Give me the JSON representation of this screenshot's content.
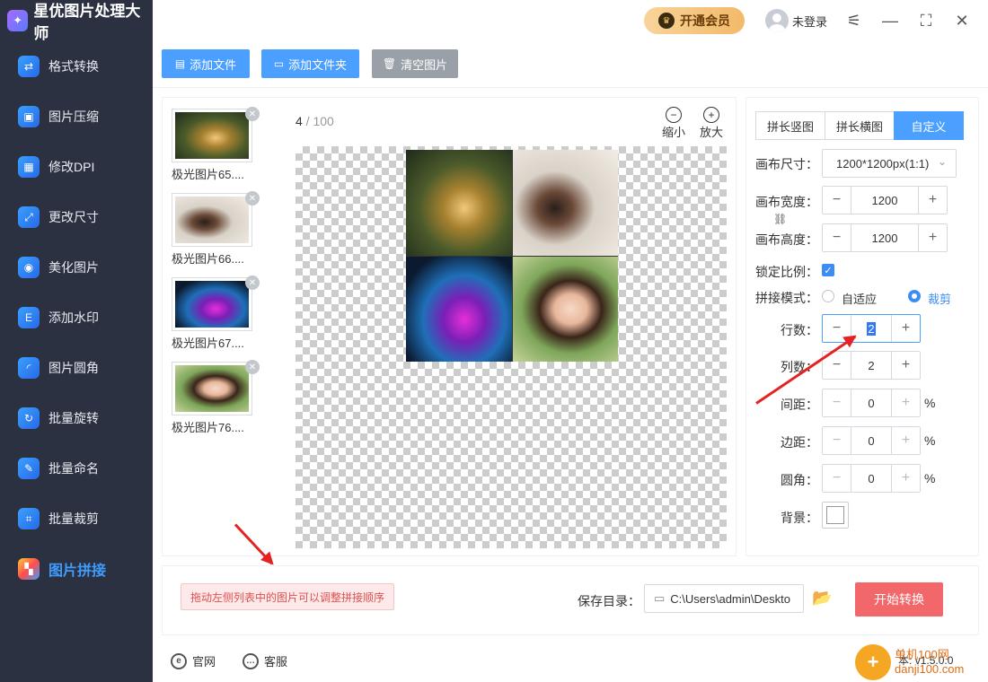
{
  "app": {
    "title": "星优图片处理大师",
    "version": "v1.5.0.0"
  },
  "sidebar": {
    "items": [
      {
        "label": "格式转换",
        "icon": "format-convert-icon"
      },
      {
        "label": "图片压缩",
        "icon": "compress-icon"
      },
      {
        "label": "修改DPI",
        "icon": "dpi-icon"
      },
      {
        "label": "更改尺寸",
        "icon": "resize-icon"
      },
      {
        "label": "美化图片",
        "icon": "beautify-icon"
      },
      {
        "label": "添加水印",
        "icon": "watermark-icon"
      },
      {
        "label": "图片圆角",
        "icon": "round-corner-icon"
      },
      {
        "label": "批量旋转",
        "icon": "rotate-icon"
      },
      {
        "label": "批量命名",
        "icon": "rename-icon"
      },
      {
        "label": "批量裁剪",
        "icon": "crop-icon"
      },
      {
        "label": "图片拼接",
        "icon": "stitch-icon",
        "active": true
      }
    ]
  },
  "header": {
    "vip_label": "开通会员",
    "user_label": "未登录"
  },
  "toolbar": {
    "add_file": "添加文件",
    "add_folder": "添加文件夹",
    "clear": "清空图片"
  },
  "files": [
    {
      "name": "极光图片65...."
    },
    {
      "name": "极光图片66...."
    },
    {
      "name": "极光图片67...."
    },
    {
      "name": "极光图片76...."
    }
  ],
  "preview": {
    "current": "4",
    "separator": " / ",
    "total": "100",
    "zoom_out": "缩小",
    "zoom_in": "放大"
  },
  "settings": {
    "tabs": [
      "拼长竖图",
      "拼长横图",
      "自定义"
    ],
    "active_tab": 2,
    "canvas_size_label": "画布尺寸：",
    "canvas_size_value": "1200*1200px(1:1)",
    "canvas_width_label": "画布宽度：",
    "canvas_width": "1200",
    "canvas_height_label": "画布高度：",
    "canvas_height": "1200",
    "lock_ratio_label": "锁定比例：",
    "lock_ratio": true,
    "mode_label": "拼接模式：",
    "mode_options": [
      "自适应",
      "裁剪"
    ],
    "mode_selected": "裁剪",
    "rows_label": "行数：",
    "rows": "2",
    "cols_label": "列数：",
    "cols": "2",
    "spacing_label": "间距：",
    "spacing": "0",
    "margin_label": "边距：",
    "margin": "0",
    "corner_label": "圆角：",
    "corner": "0",
    "percent": "%",
    "background_label": "背景：",
    "background_color": "#ffffff"
  },
  "bottom": {
    "hint": "拖动左侧列表中的图片可以调整拼接顺序",
    "save_label": "保存目录：",
    "save_path": "C:\\Users\\admin\\Deskto",
    "start_label": "开始转换"
  },
  "footer": {
    "official": "官网",
    "support": "客服",
    "version_prefix": "本:"
  },
  "watermark": {
    "logo": "+",
    "line1": "单机100网",
    "line2": "danji100.com"
  },
  "colors": {
    "accent": "#4a9fff",
    "sidebar_bg": "#2b3140",
    "start_button": "#f2686a",
    "annotation_arrow": "#e52222"
  }
}
